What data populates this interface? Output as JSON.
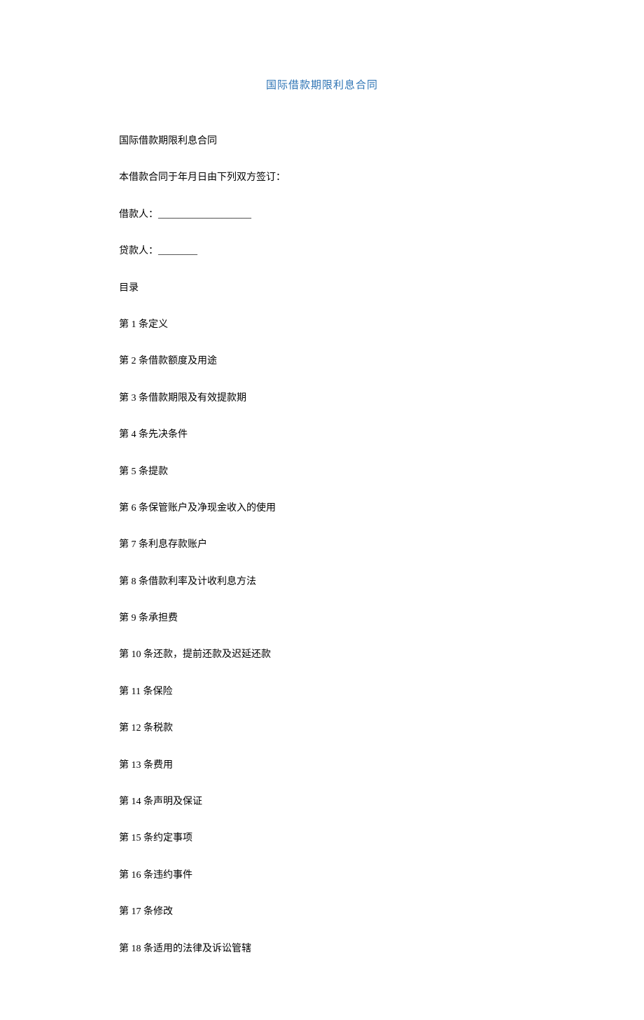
{
  "title": "国际借款期限利息合同",
  "paragraphs": [
    "国际借款期限利息合同",
    "本借款合同于年月日由下列双方签订：",
    "借款人：___________________",
    "贷款人：________",
    "目录",
    "第 1 条定义",
    "第 2 条借款额度及用途",
    "第 3 条借款期限及有效提款期",
    "第 4 条先决条件",
    "第 5 条提款",
    "第 6 条保管账户及净现金收入的使用",
    "第 7 条利息存款账户",
    "第 8 条借款利率及计收利息方法",
    "第 9 条承担费",
    "第 10 条还款，提前还款及迟延还款",
    "第 11 条保险",
    "第 12 条税款",
    "第 13 条费用",
    "第 14 条声明及保证",
    "第 15 条约定事项",
    "第 16 条违约事件",
    "第 17 条修改",
    "第 18 条适用的法律及诉讼管辖"
  ]
}
